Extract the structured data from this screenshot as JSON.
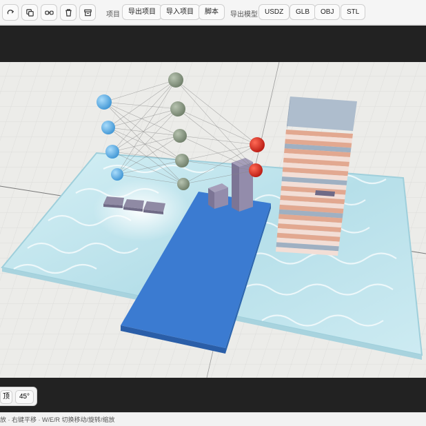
{
  "toolbar": {
    "icons": [
      "redo-icon",
      "duplicate-icon",
      "link-icon",
      "trash-icon",
      "archive-icon"
    ],
    "project_label": "项目",
    "export_project": "导出项目",
    "import_project": "导入项目",
    "script": "脚本",
    "export_model_label": "导出模型",
    "formats": [
      "USDZ",
      "GLB",
      "OBJ",
      "STL"
    ]
  },
  "view_controls": {
    "top": "顶",
    "angle": "45°"
  },
  "status": {
    "hint": "放 · 右键平移 · W/E/R 切换移动/旋转/缩放"
  },
  "colors": {
    "accent_blue": "#3b7bd1",
    "water": "#bfe6ef",
    "node_blue": "#5fb0e8",
    "node_gray": "#8c9b86",
    "node_red": "#d8291f",
    "building_stripe": "#e2a890",
    "building_roof": "#aebdcd"
  }
}
